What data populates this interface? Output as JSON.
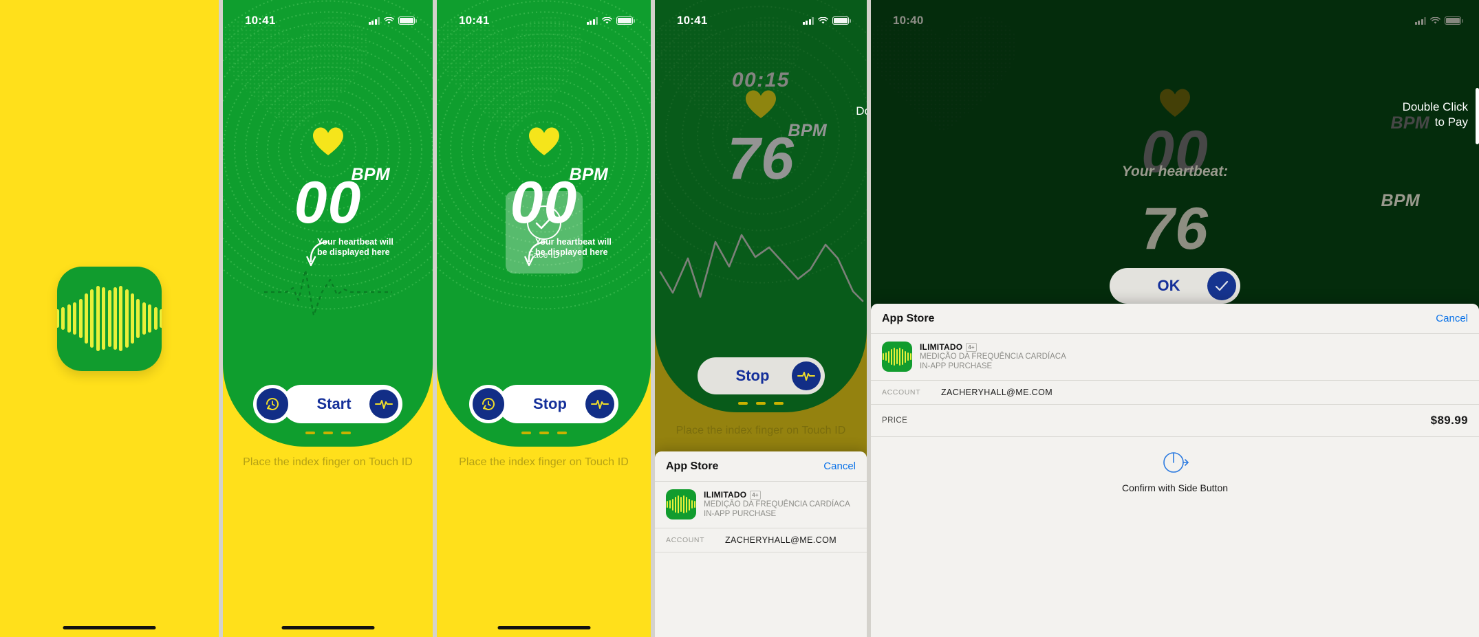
{
  "app": {
    "icon_name": "heartbeat-bars-app-icon",
    "brand_green": "#0f9e2e",
    "brand_yellow": "#ffe01b",
    "brand_navy": "#122e86",
    "heart_yellow": "#f5e51b"
  },
  "panels": [
    {
      "id": "splash",
      "kind": "splash",
      "status_bar": null
    },
    {
      "id": "ready",
      "kind": "measure",
      "status_bar": {
        "time": "10:41",
        "signal": "cellular-signal-icon",
        "wifi": "wifi-icon",
        "battery": "battery-full-icon"
      },
      "bpm_label": "BPM",
      "bpm_value": "00",
      "annotation": "Your heartbeat will be displayed here",
      "annotation_line1": "Your heartbeat will",
      "annotation_line2": "be displayed here",
      "primary_button": "Start",
      "history_icon": "history-clock-icon",
      "pulse_icon": "pulse-wave-icon",
      "caption": "Place the index finger on Touch ID"
    },
    {
      "id": "faceid",
      "kind": "measure-faceid",
      "status_bar": {
        "time": "10:41",
        "signal": "cellular-signal-icon",
        "wifi": "wifi-icon",
        "battery": "battery-full-icon"
      },
      "bpm_label": "BPM",
      "bpm_value": "00",
      "annotation_line1": "Your heartbeat will",
      "annotation_line2": "be displayed here",
      "primary_button": "Stop",
      "history_icon": "history-clock-icon",
      "pulse_icon": "pulse-wave-icon",
      "caption": "Place the index finger on Touch ID",
      "faceid": {
        "label": "Face ID",
        "icon": "checkmark-circle-icon"
      }
    },
    {
      "id": "measuring-purchase",
      "kind": "measuring-with-sheet",
      "status_bar": {
        "time": "10:41",
        "signal": "cellular-signal-icon",
        "wifi": "wifi-icon",
        "battery": "battery-full-icon"
      },
      "timer": "00:15",
      "bpm_label": "BPM",
      "bpm_value": "76",
      "primary_button": "Stop",
      "pulse_icon": "pulse-wave-icon",
      "caption": "Place the index finger on Touch ID",
      "double_click_text": "Do"
    },
    {
      "id": "confirm-pay",
      "kind": "sheet-confirm",
      "status_bar": {
        "time": "10:40",
        "signal": "cellular-signal-icon",
        "wifi": "wifi-icon",
        "battery": "battery-full-icon"
      },
      "double_click_line1": "Double Click",
      "double_click_line2": "to Pay",
      "ghost_heading": "Your heartbeat:",
      "bpm_label": "BPM",
      "bpm_value": "76",
      "ok_button": "OK",
      "ok_icon": "checkmark-circle-icon"
    }
  ],
  "sheet": {
    "title": "App Store",
    "cancel": "Cancel",
    "app_name": "ILIMITADO",
    "age_rating": "4+",
    "app_subtitle_line1": "MEDIÇÃO DA FREQUÊNCIA CARDÍACA",
    "app_subtitle_line2": "IN-APP PURCHASE",
    "account_label": "ACCOUNT",
    "account_value": "ZACHERYHALL@ME.COM",
    "price_label": "PRICE",
    "price_value": "$89.99",
    "confirm_label": "Confirm with Side Button",
    "confirm_icon": "side-button-press-icon",
    "app_icon": "heartbeat-bars-app-icon"
  }
}
